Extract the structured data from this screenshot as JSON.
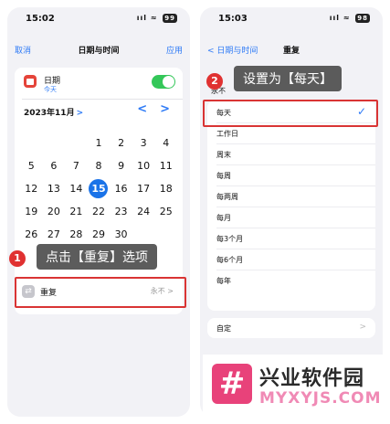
{
  "left_phone": {
    "status": {
      "time": "15:02",
      "signal": "ııl",
      "wifi": "≈",
      "battery": "99"
    },
    "nav": {
      "cancel": "取消",
      "title": "日期与时间",
      "apply": "应用"
    },
    "date_row": {
      "label": "日期",
      "sub": "今天",
      "toggle_on": true
    },
    "calendar": {
      "month": "2023年11月",
      "month_chevron": ">",
      "prev": "<",
      "next": ">",
      "weekdays": [
        "",
        "",
        "",
        "",
        "",
        "",
        ""
      ],
      "weeks": [
        [
          "",
          "",
          "",
          "1",
          "2",
          "3",
          "4"
        ],
        [
          "5",
          "6",
          "7",
          "8",
          "9",
          "10",
          "11"
        ],
        [
          "12",
          "13",
          "14",
          "15",
          "16",
          "17",
          "18"
        ],
        [
          "19",
          "20",
          "21",
          "22",
          "23",
          "24",
          "25"
        ],
        [
          "26",
          "27",
          "28",
          "29",
          "30",
          "",
          ""
        ]
      ],
      "selected": "15"
    },
    "repeat": {
      "label": "重复",
      "value": "永不 >"
    },
    "annotation": {
      "number": "1",
      "text": "点击【重复】选项"
    }
  },
  "right_phone": {
    "status": {
      "time": "15:03",
      "signal": "ııl",
      "wifi": "≈",
      "battery": "98"
    },
    "nav": {
      "back": "< 日期与时间",
      "title": "重复"
    },
    "options": [
      {
        "label": "永不",
        "checked": false
      },
      {
        "label": "每天",
        "checked": true
      },
      {
        "label": "工作日",
        "checked": false
      },
      {
        "label": "周末",
        "checked": false
      },
      {
        "label": "每周",
        "checked": false
      },
      {
        "label": "每两周",
        "checked": false
      },
      {
        "label": "每月",
        "checked": false
      },
      {
        "label": "每3个月",
        "checked": false
      },
      {
        "label": "每6个月",
        "checked": false
      },
      {
        "label": "每年",
        "checked": false
      }
    ],
    "check_mark": "✓",
    "custom": {
      "label": "自定",
      "chevron": ">"
    },
    "annotation": {
      "number": "2",
      "text": "设置为【每天】"
    }
  },
  "watermark": {
    "mark": "#",
    "name_cn": "兴业软件园",
    "name_en": "MYXYJS.COM"
  },
  "colors": {
    "accent": "#2f7bf6",
    "selected_day": "#1a73e8",
    "highlight": "#d93434",
    "toggle": "#34c759",
    "brand": "#e8427a"
  }
}
